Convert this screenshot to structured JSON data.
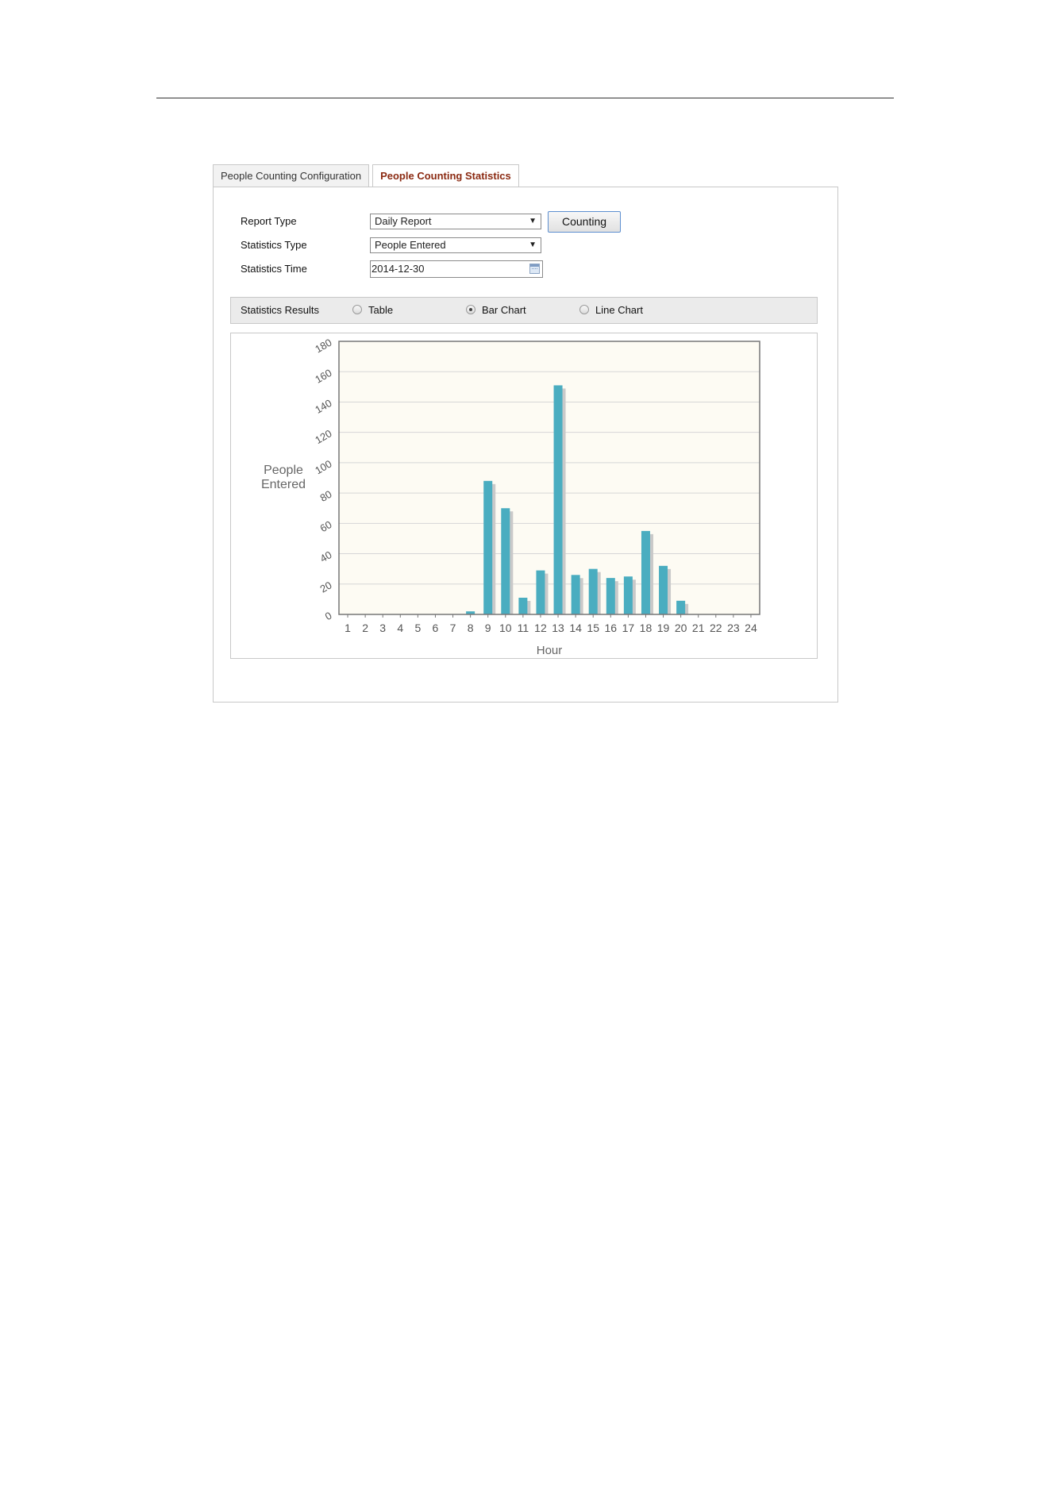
{
  "tabs": [
    {
      "label": "People Counting Configuration",
      "active": false
    },
    {
      "label": "People Counting Statistics",
      "active": true
    }
  ],
  "form": {
    "report_type_label": "Report Type",
    "report_type_value": "Daily Report",
    "statistics_type_label": "Statistics Type",
    "statistics_type_value": "People Entered",
    "statistics_time_label": "Statistics Time",
    "statistics_time_value": "2014-12-30",
    "counting_button": "Counting"
  },
  "results": {
    "label": "Statistics Results",
    "options": [
      {
        "label": "Table",
        "checked": false
      },
      {
        "label": "Bar Chart",
        "checked": true
      },
      {
        "label": "Line Chart",
        "checked": false
      }
    ]
  },
  "colors": {
    "bar": "#4aadc0",
    "bar_shadow": "#c9c9c9",
    "plot_bg": "#fdfbf3",
    "active_tab": "#8b2a12"
  },
  "chart_data": {
    "type": "bar",
    "categories": [
      "1",
      "2",
      "3",
      "4",
      "5",
      "6",
      "7",
      "8",
      "9",
      "10",
      "11",
      "12",
      "13",
      "14",
      "15",
      "16",
      "17",
      "18",
      "19",
      "20",
      "21",
      "22",
      "23",
      "24"
    ],
    "values": [
      0,
      0,
      0,
      0,
      0,
      0,
      0,
      2,
      88,
      70,
      11,
      29,
      151,
      26,
      30,
      24,
      25,
      55,
      32,
      9,
      0,
      0,
      0,
      0
    ],
    "title": "",
    "xlabel": "Hour",
    "ylabel": "People Entered",
    "ylim": [
      0,
      180
    ],
    "yticks": [
      0,
      20,
      40,
      60,
      80,
      100,
      120,
      140,
      160,
      180
    ],
    "grid": true,
    "legend": "none"
  }
}
